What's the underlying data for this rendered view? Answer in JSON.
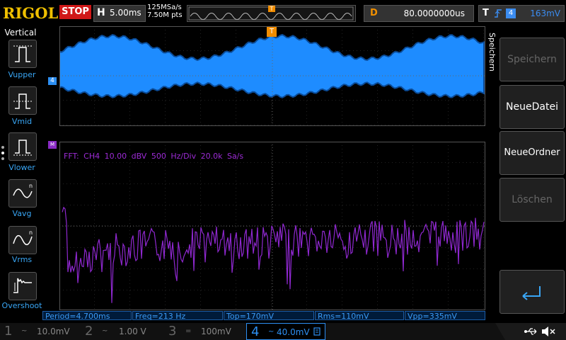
{
  "topbar": {
    "logo": "RIGOL",
    "run_status": "STOP",
    "timebase_label": "H",
    "timebase_value": "5.00ms",
    "sample_rate": "125MSa/s",
    "memory_depth": "7.50M pts",
    "trigger_marker": "T",
    "delay_label": "D",
    "delay_value": "80.0000000us",
    "trigger_label": "T",
    "trigger_source": "4",
    "trigger_level": "163mV"
  },
  "left_menu": {
    "title": "Vertical",
    "items": [
      {
        "label": "Vupper",
        "icon": "vupper-icon"
      },
      {
        "label": "Vmid",
        "icon": "vmid-icon"
      },
      {
        "label": "Vlower",
        "icon": "vlower-icon"
      },
      {
        "label": "Vavg",
        "icon": "vavg-icon"
      },
      {
        "label": "Vrms",
        "icon": "vrms-icon"
      },
      {
        "label": "Overshoot",
        "icon": "overshoot-icon"
      }
    ]
  },
  "waveform": {
    "channel_marker": "4",
    "trigger_marker": "T",
    "color": "#1e8cff"
  },
  "fft": {
    "marker": "M",
    "label": "FFT:  CH4  10.00 dBV   500 Hz/Div    20.0k Sa/s",
    "color": "#9c2bd5"
  },
  "measurements": [
    {
      "text": "Period=4.700ms"
    },
    {
      "text": "Freq=213 Hz"
    },
    {
      "text": "Top=170mV"
    },
    {
      "text": "Rms=110mV"
    },
    {
      "text": "Vpp=335mV"
    }
  ],
  "right_menu": {
    "title": "Speichern",
    "buttons": [
      {
        "label": "Speichern",
        "enabled": false
      },
      {
        "label": "NeueDatei",
        "enabled": true
      },
      {
        "label": "NeueOrdner",
        "enabled": true
      },
      {
        "label": "Löschen",
        "enabled": false
      }
    ],
    "back_icon": "return-arrow-icon"
  },
  "channels": [
    {
      "num": "1",
      "coupling": "~",
      "scale": "10.0mV"
    },
    {
      "num": "2",
      "coupling": "~",
      "scale": "1.00 V"
    },
    {
      "num": "3",
      "coupling": "=",
      "scale": "100mV"
    },
    {
      "num": "4",
      "coupling": "~",
      "scale": "40.0mV",
      "active": true
    }
  ],
  "status_icons": [
    "usb-icon",
    "speaker-mute-icon"
  ]
}
